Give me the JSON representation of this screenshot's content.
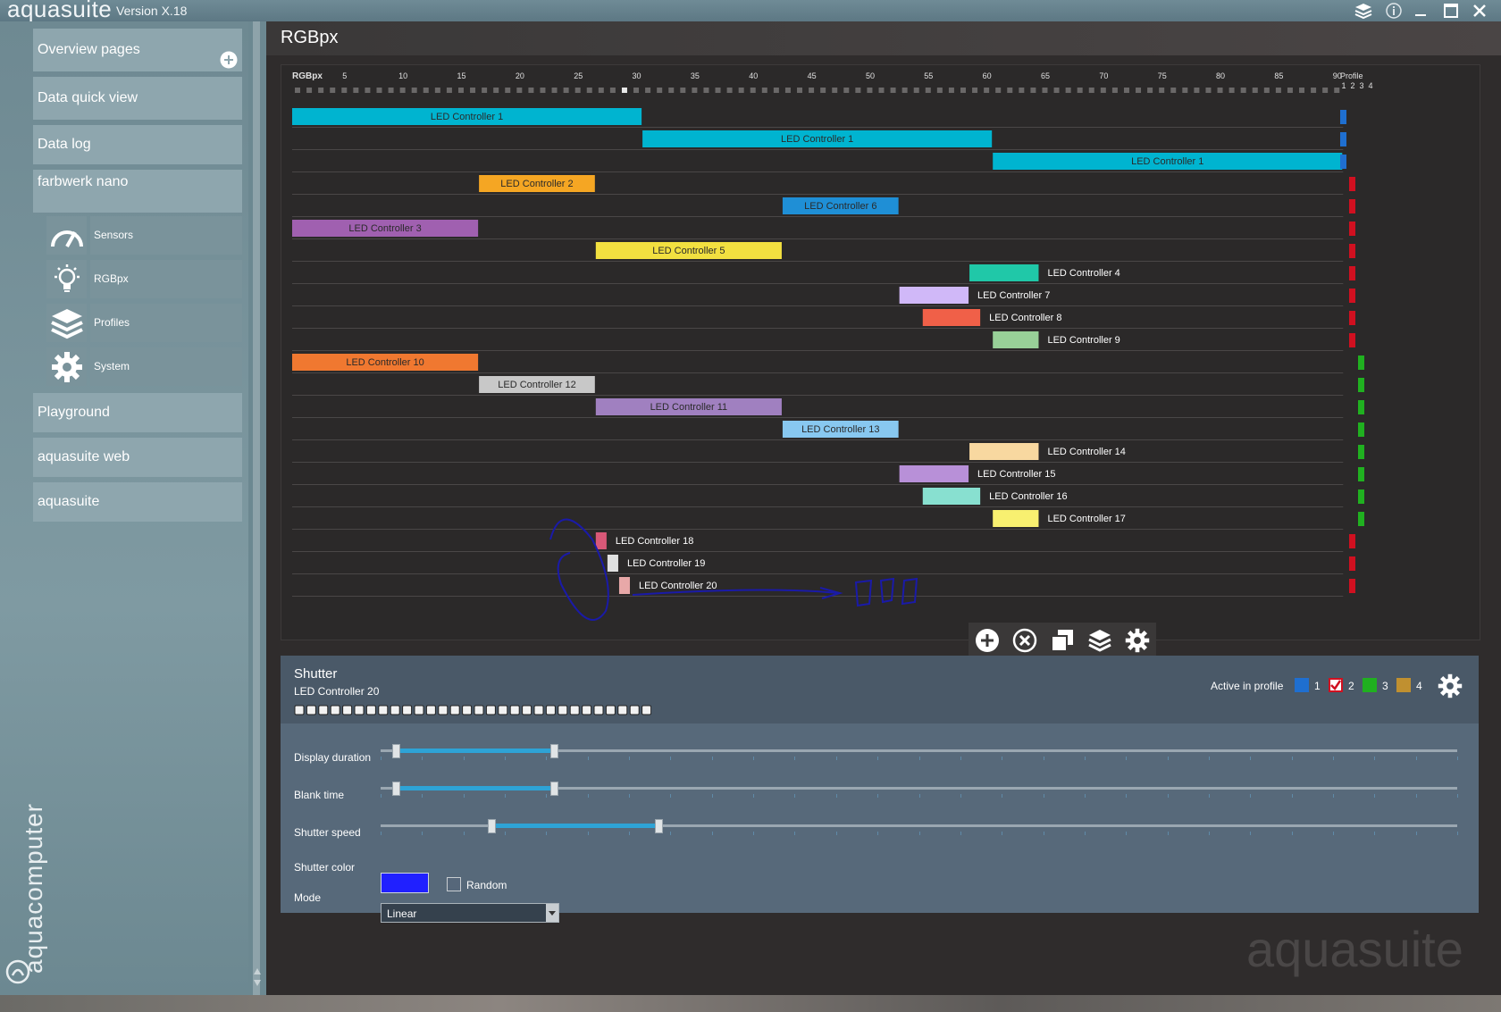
{
  "app": {
    "name": "aquasuite",
    "version": "Version X.18"
  },
  "sidebar": {
    "overview": "Overview pages",
    "quickview": "Data quick view",
    "datalog": "Data log",
    "device": "farbwerk nano",
    "subitems": [
      {
        "label": "Sensors",
        "icon": "gauge-icon"
      },
      {
        "label": "RGBpx",
        "icon": "lightbulb-icon"
      },
      {
        "label": "Profiles",
        "icon": "layers-icon"
      },
      {
        "label": "System",
        "icon": "gear-icon"
      }
    ],
    "playground": "Playground",
    "web": "aquasuite web",
    "aquasuite": "aquasuite",
    "brand": "aquacomputer"
  },
  "page": {
    "title": "RGBpx"
  },
  "timeline": {
    "axis_title": "RGBpx",
    "ticks": [
      "5",
      "10",
      "15",
      "20",
      "25",
      "30",
      "35",
      "40",
      "45",
      "50",
      "55",
      "60",
      "65",
      "70",
      "75",
      "80",
      "85",
      "90"
    ],
    "profile_header": "Profile",
    "profile_numbers": [
      "1",
      "2",
      "3",
      "4"
    ],
    "rows": [
      {
        "label": "LED Controller 1",
        "start": 1,
        "end": 30,
        "color": "#00b4d0",
        "label_inside": true,
        "profile": 1
      },
      {
        "label": "LED Controller 1",
        "start": 31,
        "end": 60,
        "color": "#00b4d0",
        "label_inside": true,
        "profile": 1
      },
      {
        "label": "LED Controller 1",
        "start": 61,
        "end": 90,
        "color": "#00b4d0",
        "label_inside": true,
        "profile": 1
      },
      {
        "label": "LED Controller 2",
        "start": 17,
        "end": 26,
        "color": "#f5a623",
        "label_inside": true,
        "profile": 2
      },
      {
        "label": "LED Controller 6",
        "start": 43,
        "end": 52,
        "color": "#1f8fd6",
        "label_inside": true,
        "profile": 2
      },
      {
        "label": "LED Controller 3",
        "start": 1,
        "end": 16,
        "color": "#a060b0",
        "label_inside": true,
        "profile": 2
      },
      {
        "label": "LED Controller 5",
        "start": 27,
        "end": 42,
        "color": "#f2e040",
        "label_inside": true,
        "profile": 2
      },
      {
        "label": "LED Controller 4",
        "start": 59,
        "end": 64,
        "color": "#20c8a8",
        "label_inside": false,
        "profile": 2
      },
      {
        "label": "LED Controller 7",
        "start": 53,
        "end": 58,
        "color": "#d0b8f8",
        "label_inside": false,
        "profile": 2
      },
      {
        "label": "LED Controller 8",
        "start": 55,
        "end": 59,
        "color": "#f06048",
        "label_inside": false,
        "profile": 2
      },
      {
        "label": "LED Controller 9",
        "start": 61,
        "end": 64,
        "color": "#98d098",
        "label_inside": false,
        "profile": 2
      },
      {
        "label": "LED Controller 10",
        "start": 1,
        "end": 16,
        "color": "#f07830",
        "label_inside": true,
        "profile": 3
      },
      {
        "label": "LED Controller 12",
        "start": 17,
        "end": 26,
        "color": "#c8c8c8",
        "label_inside": true,
        "profile": 3
      },
      {
        "label": "LED Controller 11",
        "start": 27,
        "end": 42,
        "color": "#a080c0",
        "label_inside": true,
        "profile": 3
      },
      {
        "label": "LED Controller 13",
        "start": 43,
        "end": 52,
        "color": "#88c8f0",
        "label_inside": true,
        "profile": 3
      },
      {
        "label": "LED Controller 14",
        "start": 59,
        "end": 64,
        "color": "#f8d8a0",
        "label_inside": false,
        "profile": 3
      },
      {
        "label": "LED Controller 15",
        "start": 53,
        "end": 58,
        "color": "#b890d8",
        "label_inside": false,
        "profile": 3
      },
      {
        "label": "LED Controller 16",
        "start": 55,
        "end": 59,
        "color": "#88e0d0",
        "label_inside": false,
        "profile": 3
      },
      {
        "label": "LED Controller 17",
        "start": 61,
        "end": 64,
        "color": "#f8f070",
        "label_inside": false,
        "profile": 3
      },
      {
        "label": "LED Controller 18",
        "start": 27,
        "end": 27,
        "color": "#d85878",
        "label_inside": false,
        "profile": 2
      },
      {
        "label": "LED Controller 19",
        "start": 28,
        "end": 28,
        "color": "#e0e0e0",
        "label_inside": false,
        "profile": 2
      },
      {
        "label": "LED Controller 20",
        "start": 29,
        "end": 29,
        "color": "#e8a8a8",
        "label_inside": false,
        "profile": 2
      }
    ],
    "profile_colors": {
      "1": "#1f6fd0",
      "2": "#d01020",
      "3": "#20b020",
      "4": "#c09030"
    }
  },
  "toolbar": {
    "icons": [
      "add-icon",
      "remove-icon",
      "copy-icon",
      "layers-icon",
      "settings-icon"
    ]
  },
  "shutter": {
    "title": "Shutter",
    "subtitle": "LED Controller 20",
    "pixel_count": 30,
    "active_label": "Active in profile",
    "profiles": [
      {
        "num": "1",
        "color": "#1f6fd0",
        "checked": false
      },
      {
        "num": "2",
        "color": "#d01020",
        "checked": true
      },
      {
        "num": "3",
        "color": "#20b020",
        "checked": false
      },
      {
        "num": "4",
        "color": "#c09030",
        "checked": false
      }
    ],
    "display_duration_label": "Display duration",
    "blank_time_label": "Blank time",
    "shutter_speed_label": "Shutter speed",
    "shutter_color_label": "Shutter color",
    "shutter_color": "#2020ff",
    "random_label": "Random",
    "mode_label": "Mode",
    "mode_value": "Linear",
    "sliders": {
      "display_duration": [
        0.014,
        0.161
      ],
      "blank_time": [
        0.014,
        0.161
      ],
      "shutter_speed": [
        0.103,
        0.258
      ]
    }
  },
  "watermark": "aquasuite"
}
